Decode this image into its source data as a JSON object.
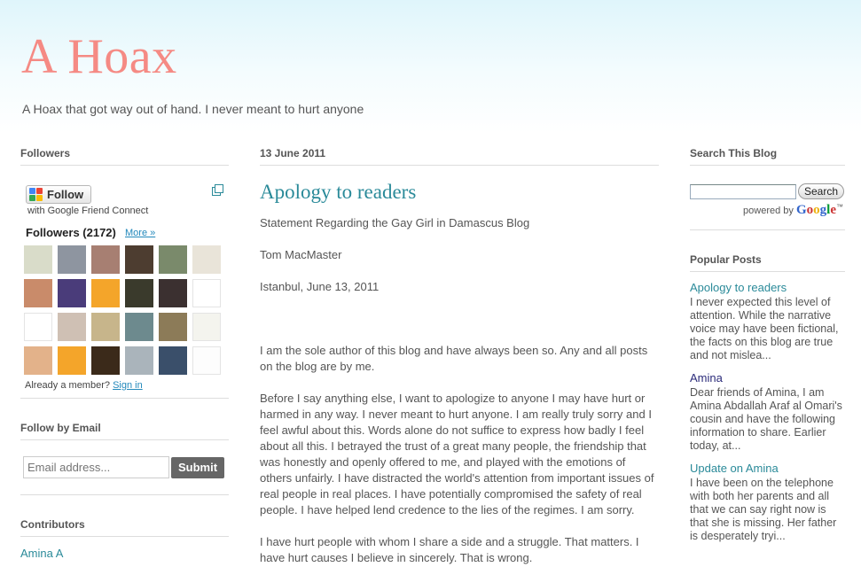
{
  "header": {
    "title": "A Hoax",
    "description": "A Hoax that got way out of hand. I never meant to hurt anyone"
  },
  "followers_widget": {
    "title": "Followers",
    "follow_label": "Follow",
    "gfc_label": "with Google Friend Connect",
    "followers_count_label": "Followers (2172)",
    "more_label": "More »",
    "already_member": "Already a member?",
    "sign_in": "Sign in",
    "avatar_colors": [
      "#d9dcc9",
      "#8e95a0",
      "#a77f72",
      "#4d3d30",
      "#7a8a6b",
      "#e9e4d9",
      "#c98b6a",
      "#4a3c7a",
      "#f4a52a",
      "#3a3a2c",
      "#3b3030",
      "#ffffff",
      "#ffffff",
      "#cfc0b4",
      "#c7b58b",
      "#6d8a8e",
      "#8c7b58",
      "#f4f4ee",
      "#e3b28a",
      "#f4a52a",
      "#3b2a1a",
      "#aab4bb",
      "#3a4f6a",
      "#fdfdfd"
    ]
  },
  "follow_by_email": {
    "title": "Follow by Email",
    "placeholder": "Email address...",
    "submit_label": "Submit"
  },
  "contributors": {
    "title": "Contributors",
    "first": "Amina A"
  },
  "post": {
    "date": "13 June 2011",
    "title": "Apology to readers",
    "paragraphs": [
      "Statement Regarding the Gay Girl in Damascus Blog",
      "Tom MacMaster",
      "Istanbul, June 13, 2011",
      "",
      "I am the sole author of this blog and have always been so. Any and all posts on the blog are by me.",
      "Before I say anything else, I want to apologize to anyone I may have hurt or harmed in any way. I never meant to hurt anyone. I am really truly sorry and I feel awful about this. Words alone do not suffice to express how badly I feel about all this. I betrayed the trust of a great many people, the friendship that was honestly and openly offered to me, and played with the emotions of others unfairly. I have distracted the world's attention from important issues of real people in real places. I have potentially compromised the safety of real people. I have helped lend credence to the lies of the regimes. I am sorry.",
      "I have hurt people with whom I share a side and a struggle. That matters. I have hurt causes I believe in sincerely. That is wrong."
    ]
  },
  "search_widget": {
    "title": "Search This Blog",
    "button_label": "Search",
    "powered_by": "powered by",
    "google": "Google",
    "tm": "™"
  },
  "popular_posts": {
    "title": "Popular Posts",
    "items": [
      {
        "title": "Apology to readers",
        "snippet": "I never expected this level of attention. While the narrative voice may have been fictional, the facts on this blog are true and not mislea..."
      },
      {
        "title": "Amina",
        "snippet": "Dear friends of Amina, I am Amina Abdallah Araf al Omari's cousin and have the following information to share. Earlier today, at..."
      },
      {
        "title": "Update on Amina",
        "snippet": "I have been on the telephone with both her parents and all that we can say right now is that she is missing. Her father is desperately tryi..."
      }
    ]
  }
}
